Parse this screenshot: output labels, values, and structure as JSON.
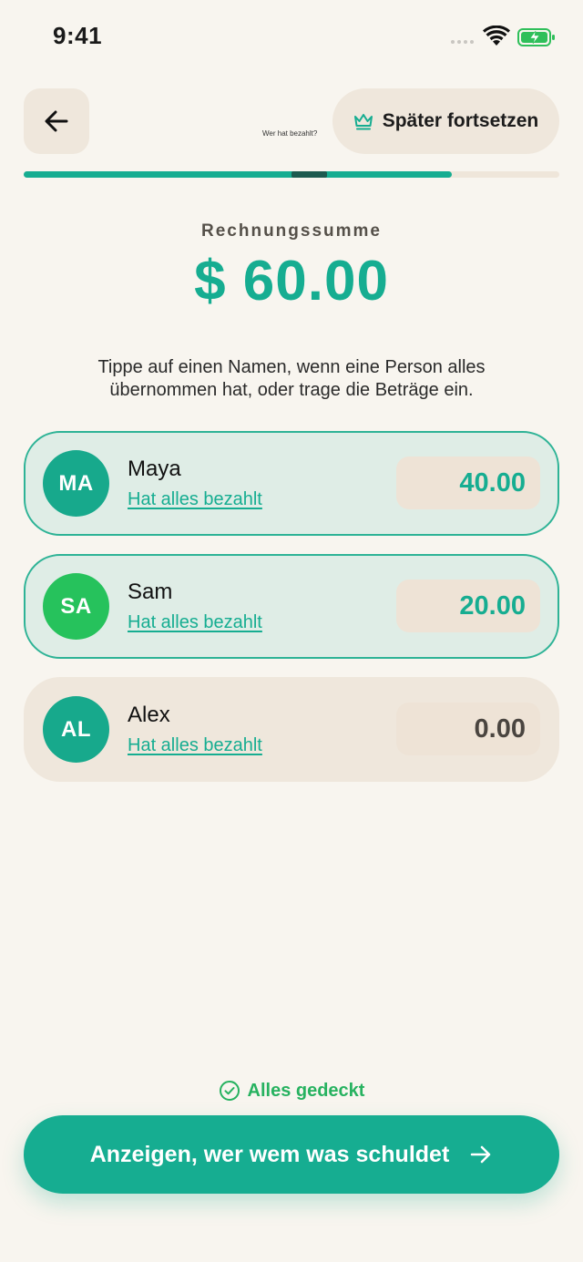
{
  "status_bar": {
    "time": "9:41"
  },
  "header": {
    "title": "Wer hat bezahlt?",
    "later_label": "Später fortsetzen",
    "progress": 0.8
  },
  "total": {
    "label": "Rechnungssumme",
    "amount": "$ 60.00"
  },
  "instructions": "Tippe auf einen Namen, wenn eine Person alles übernommen hat, oder trage die Beträge ein.",
  "people": [
    {
      "initials": "MA",
      "name": "Maya",
      "link": "Hat alles bezahlt",
      "amount": "40.00",
      "avatar_color": "#17a98c",
      "paid": true
    },
    {
      "initials": "SA",
      "name": "Sam",
      "link": "Hat alles bezahlt",
      "amount": "20.00",
      "avatar_color": "#26c25c",
      "paid": true
    },
    {
      "initials": "AL",
      "name": "Alex",
      "link": "Hat alles bezahlt",
      "amount": "0.00",
      "avatar_color": "#17a98c",
      "paid": false
    }
  ],
  "footer": {
    "covered_label": "Alles gedeckt",
    "cta_label": "Anzeigen, wer wem was schuldet"
  },
  "colors": {
    "accent": "#16ad91",
    "success": "#27b260",
    "card_bg": "#efe7dc",
    "paid_bg": "#dfede6"
  }
}
